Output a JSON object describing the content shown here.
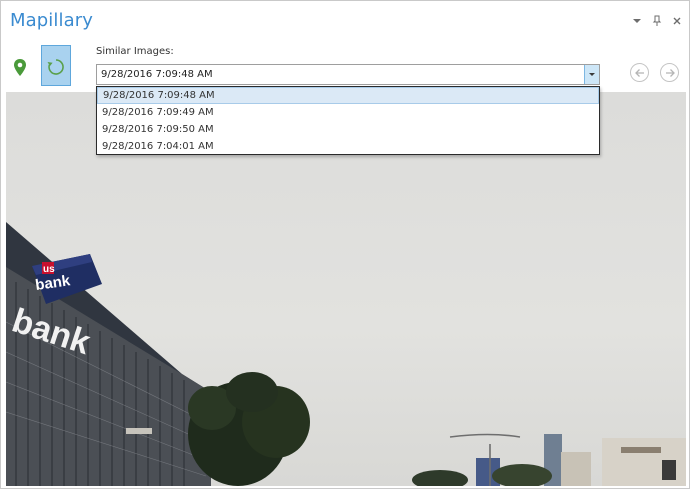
{
  "pane": {
    "title": "Mapillary",
    "controls": [
      "chevron-down-icon",
      "pin-icon",
      "close-icon"
    ]
  },
  "toolbar": {
    "location_icon": "map-pin-icon",
    "sync_icon": "refresh-icon"
  },
  "similar_images": {
    "label": "Similar Images:",
    "selected": "9/28/2016 7:09:48 AM",
    "options": [
      "9/28/2016 7:09:48 AM",
      "9/28/2016 7:09:49 AM",
      "9/28/2016 7:09:50 AM",
      "9/28/2016 7:04:01 AM"
    ]
  },
  "navigation": {
    "prev_icon": "arrow-left-icon",
    "next_icon": "arrow-right-icon"
  },
  "colors": {
    "accent": "#3b8bd0",
    "pin": "#4a9a3a",
    "selection": "#dbe9f6"
  }
}
